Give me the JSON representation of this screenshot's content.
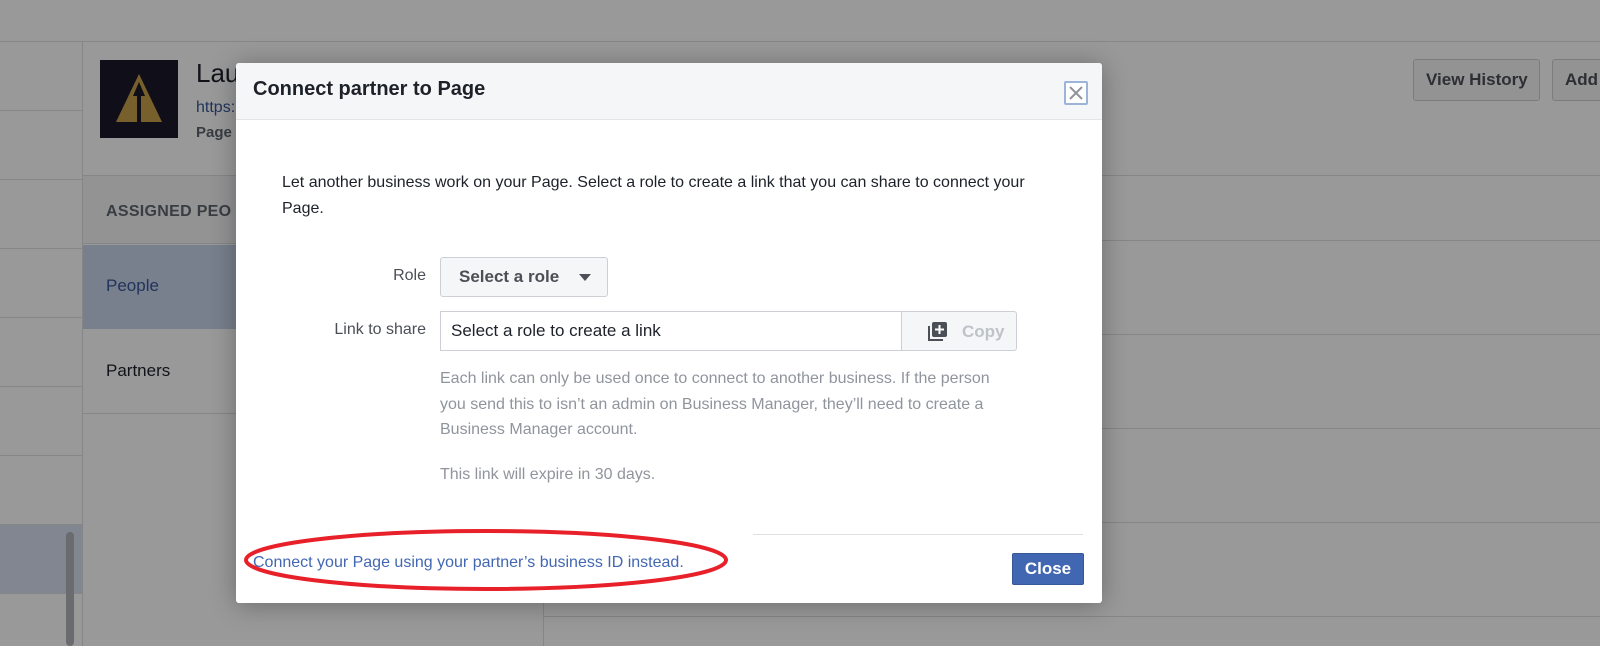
{
  "background": {
    "page": {
      "name": "Lau",
      "url": "https:",
      "meta": "Page"
    },
    "header_buttons": {
      "view_history": "View History",
      "add": "Add"
    },
    "sidebar": {
      "section_title": "ASSIGNED PEO",
      "tabs": [
        "People",
        "Partners"
      ]
    }
  },
  "dialog": {
    "title": "Connect partner to Page",
    "intro": "Let another business work on your Page. Select a role to create a link that you can share to connect your Page.",
    "role_label": "Role",
    "role_select_value": "Select a role",
    "link_label": "Link to share",
    "link_input_value": "Select a role to create a link",
    "copy_label": "Copy",
    "help_text": "Each link can only be used once to connect to another business. If the person you send this to isn’t an admin on Business Manager, they’ll need to create a Business Manager account.",
    "expire_text": "This link will expire in 30 days.",
    "business_id_link": "Connect your Page using your partner’s business ID instead.",
    "close_label": "Close"
  },
  "colors": {
    "link_blue": "#4267b2",
    "primary_button": "#4267b2",
    "annotation_red": "#e8202a"
  },
  "icons": {
    "close": "close-x-icon",
    "caret": "chevron-down-icon",
    "copy": "copy-icon",
    "logo": "page-logo-icon"
  }
}
